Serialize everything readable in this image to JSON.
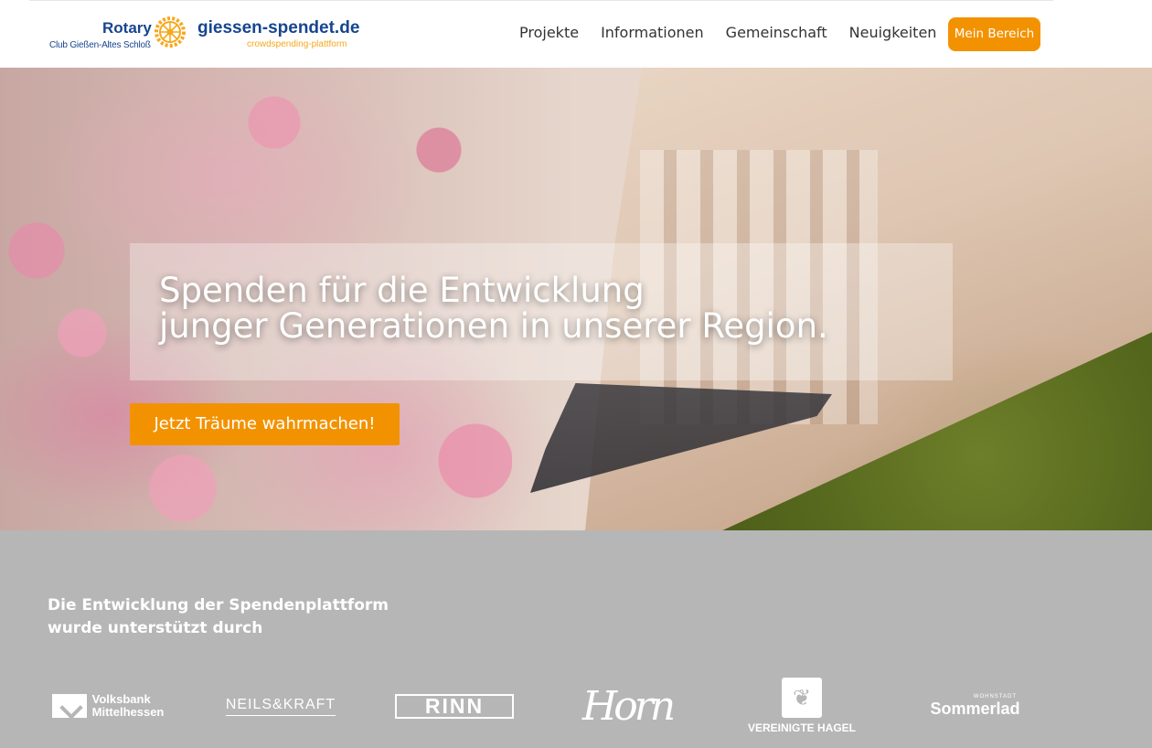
{
  "header": {
    "logo": {
      "rotary_name": "Rotary",
      "rotary_club": "Club Gießen-Altes Schloß",
      "site_name": "giessen-spendet.de",
      "site_tagline": "crowdspending-plattform"
    },
    "nav": [
      "Projekte",
      "Informationen",
      "Gemeinschaft",
      "Neuigkeiten"
    ],
    "account_button": "Mein Bereich",
    "accent_color": "#f39200"
  },
  "hero": {
    "title_line1": "Spenden für die Entwicklung",
    "title_line2": "junger Generationen in unserer Region.",
    "cta": "Jetzt Träume wahrmachen!"
  },
  "sponsors": {
    "heading_line1": "Die Entwicklung der Spendenplattform",
    "heading_line2": "wurde unterstützt durch",
    "logos": [
      {
        "name": "volksbank-mittelhessen",
        "line1": "Volksbank",
        "line2": "Mittelhessen"
      },
      {
        "name": "neils-kraft",
        "text": "NEILS&KRAFT"
      },
      {
        "name": "rinn",
        "text": "RINN"
      },
      {
        "name": "horn",
        "text": "Horn"
      },
      {
        "name": "vereinigte-hagel",
        "text": "VEREINIGTE HAGEL"
      },
      {
        "name": "sommerlad",
        "small": "WOHNSTADT",
        "text": "Sommerlad"
      }
    ],
    "background_color": "#b6b6b6"
  }
}
